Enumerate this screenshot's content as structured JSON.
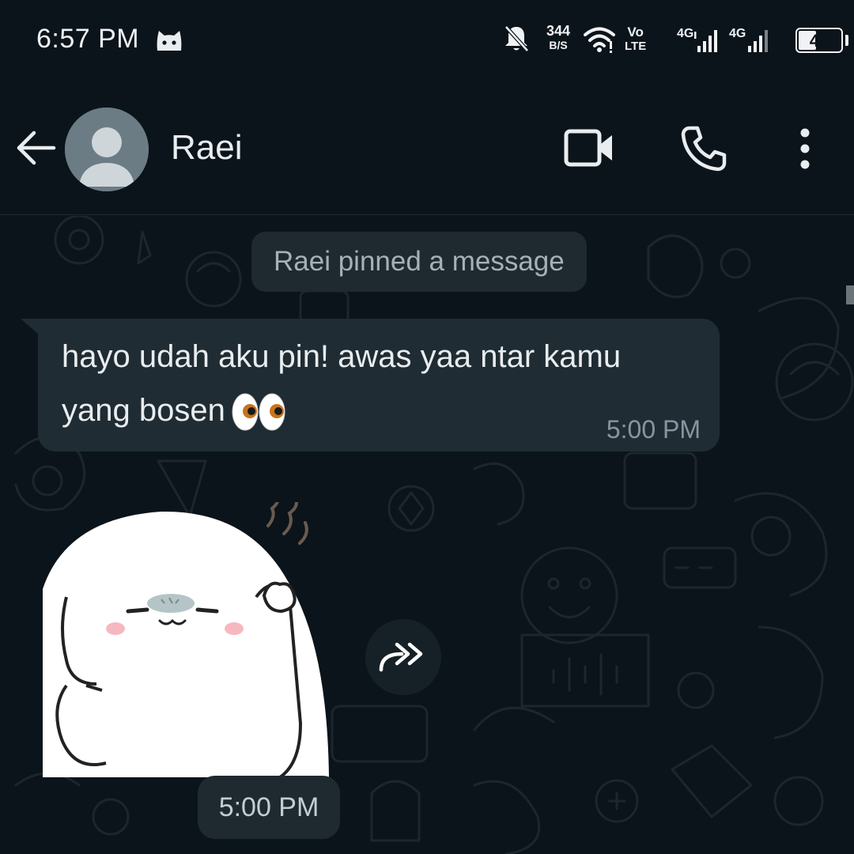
{
  "status_bar": {
    "time": "6:57 PM",
    "net_speed_value": "344",
    "net_speed_unit": "B/S",
    "volte_top": "Vo",
    "volte_bottom": "LTE",
    "sim1_label": "4G",
    "sim2_label": "4G",
    "battery": "40",
    "battery_level": 0.4,
    "icons": [
      "cat-app-icon",
      "mute-bell-icon",
      "wifi-icon",
      "signal-icon",
      "battery-icon"
    ]
  },
  "header": {
    "contact_name": "Raei",
    "icons": [
      "back-arrow-icon",
      "avatar-placeholder-icon",
      "video-call-icon",
      "phone-icon",
      "more-vert-icon"
    ]
  },
  "chat": {
    "system_message": "Raei pinned a message",
    "messages": [
      {
        "type": "text",
        "text": "hayo udah aku pin! awas yaa ntar kamu yang bosen",
        "emoji": "eyes-emoji",
        "time": "5:00 PM"
      },
      {
        "type": "sticker",
        "sticker": "white-seal-sticker",
        "time": "5:00 PM"
      }
    ],
    "forward_icon": "forward-double-arrow-icon"
  },
  "colors": {
    "background": "#0b141a",
    "bubble": "#202c33",
    "pill": "#1e2a30",
    "text_primary": "#e9edef",
    "text_secondary": "#8696a0"
  }
}
